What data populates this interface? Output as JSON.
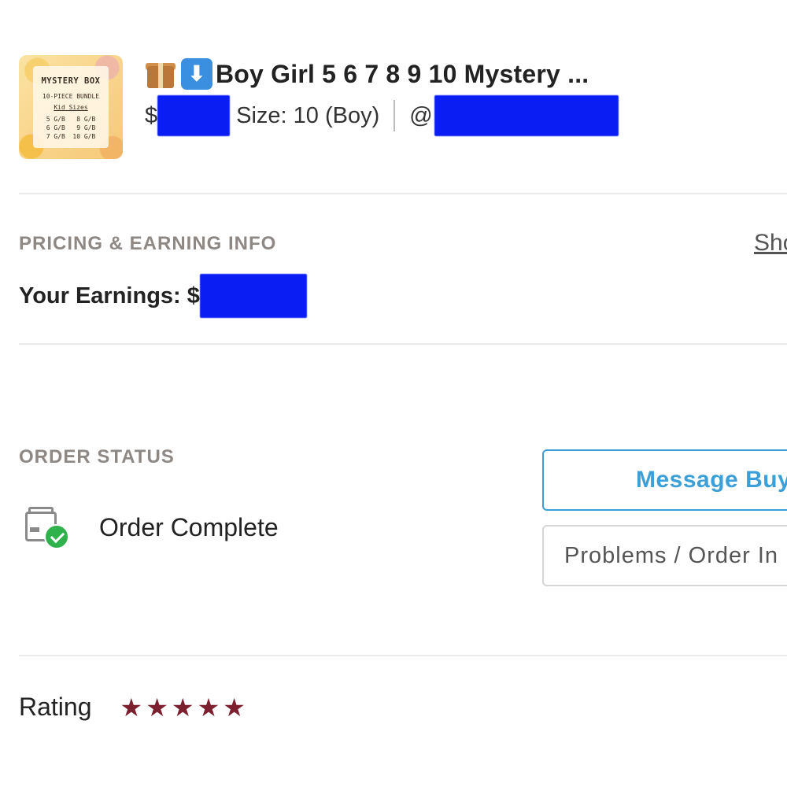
{
  "item": {
    "thumbnail": {
      "title": "MYSTERY BOX",
      "subtitle": "10-PIECE BUNDLE",
      "sizes_label": "Kid Sizes",
      "sizes_grid": "5 G/B   8 G/B\n6 G/B   9 G/B\n7 G/B  10 G/B"
    },
    "title_icons": [
      "package-icon",
      "down-arrow-icon"
    ],
    "title": "Boy Girl 5 6 7 8 9 10 Mystery ...",
    "price_prefix": "$",
    "size": "Size: 10 (Boy)",
    "seller_prefix": "@"
  },
  "pricing": {
    "section_label": "PRICING & EARNING INFO",
    "show_link": "Sho",
    "earnings_label": "Your Earnings: $"
  },
  "order_status": {
    "section_label": "ORDER STATUS",
    "status_icon": "package-check-icon",
    "status_text": "Order Complete",
    "message_button": "Message Buye",
    "problems_button": "Problems / Order In"
  },
  "rating": {
    "label": "Rating",
    "stars": 5,
    "star_color": "#7c1f2e"
  },
  "colors": {
    "accent_blue": "#3b9fd8",
    "redaction": "#0a1df2",
    "success_green": "#2fb24b"
  }
}
